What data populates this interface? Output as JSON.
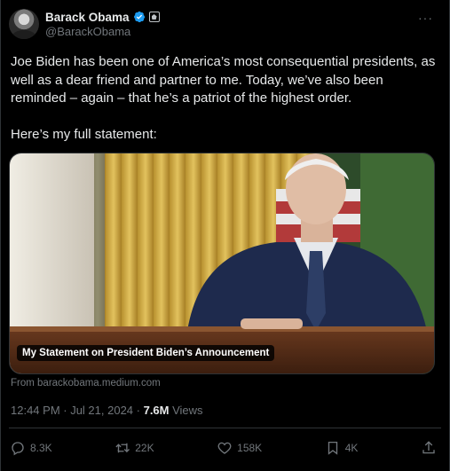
{
  "author": {
    "name": "Barack Obama",
    "handle": "@BarackObama"
  },
  "tweet": {
    "paragraph1": "Joe Biden has been one of America’s most consequential presidents, as well as a dear friend and partner to me. Today, we’ve also been reminded – again – that he’s a patriot of the highest order.",
    "paragraph2": "Here’s my full statement:"
  },
  "card": {
    "caption": "My Statement on President Biden’s Announcement",
    "source": "From barackobama.medium.com"
  },
  "meta": {
    "timestamp": "12:44 PM · Jul 21, 2024 · ",
    "views_count": "7.6M",
    "views_label": " Views"
  },
  "actions": {
    "replies": "8.3K",
    "reposts": "22K",
    "likes": "158K",
    "bookmarks": "4K"
  },
  "icons": [
    "verified-badge-icon",
    "government-label-icon",
    "more-icon",
    "reply-icon",
    "repost-icon",
    "like-icon",
    "bookmark-icon",
    "share-icon"
  ],
  "colors": {
    "background": "#000000",
    "text": "#e7e9ea",
    "muted": "#71767b",
    "verified": "#1d9bf0"
  }
}
